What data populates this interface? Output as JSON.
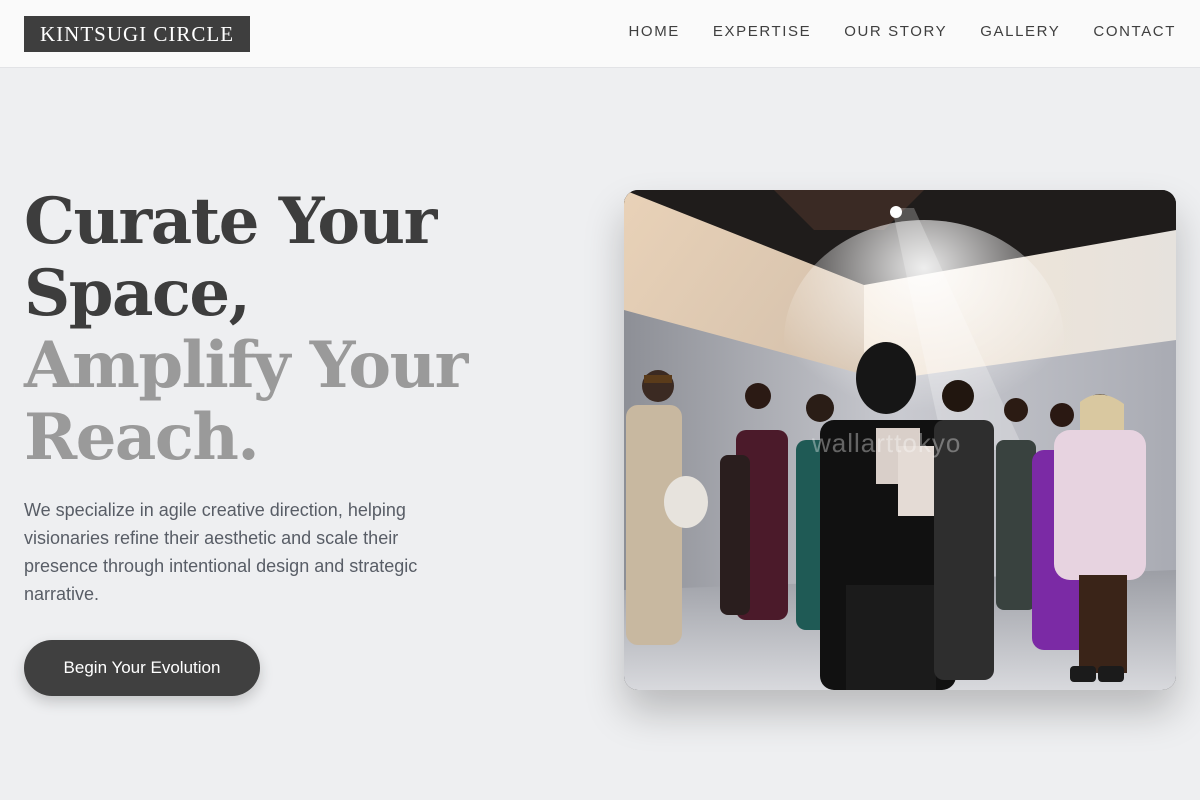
{
  "brand": {
    "name": "KINTSUGI CIRCLE"
  },
  "nav": {
    "items": [
      {
        "label": "HOME"
      },
      {
        "label": "EXPERTISE"
      },
      {
        "label": "OUR STORY"
      },
      {
        "label": "GALLERY"
      },
      {
        "label": "CONTACT"
      }
    ]
  },
  "hero": {
    "title_line1": "Curate Your",
    "title_line2": "Space,",
    "title_line3": "Amplify Your",
    "title_line4": "Reach.",
    "description": "We specialize in agile creative direction, helping visionaries refine their aesthetic and scale their presence through intentional design and strategic narrative.",
    "cta_label": "Begin Your Evolution",
    "image_watermark": "wallarttokyo"
  },
  "colors": {
    "background": "#eeeff1",
    "navbar": "#fafafa",
    "logo_bg": "#3e3e3e",
    "title_dark": "#3d3d3d",
    "title_muted": "#9a9a9a",
    "body_text": "#585d66",
    "cta_bg": "#404040"
  }
}
